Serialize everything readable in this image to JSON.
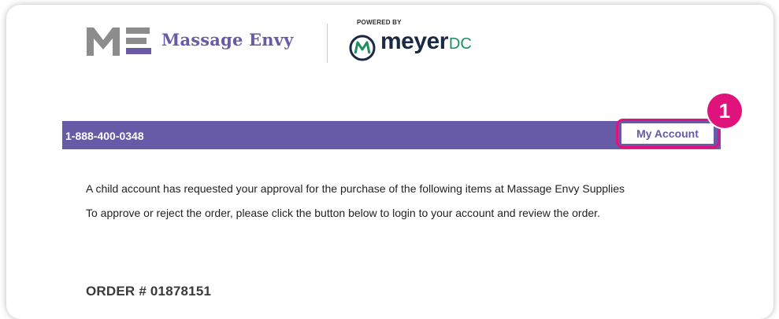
{
  "brand": {
    "mark_icon": "massage-envy-me-mark-icon",
    "name": "Massage Envy",
    "powered_by": "POWERED BY",
    "partner_icon": "meyerdc-m-icon",
    "partner_word": "meyer",
    "partner_suffix": "DC"
  },
  "header_bar": {
    "phone": "1-888-400-0348",
    "account_button": "My Account"
  },
  "annotation": {
    "step_number": "1"
  },
  "body": {
    "paragraph_1": "A child account has requested your approval for the purchase of the following items at Massage Envy Supplies",
    "paragraph_2": "To approve or reject the order, please click the button below to login to your account and review the order.",
    "order_label": "ORDER # 01878151"
  },
  "colors": {
    "brand_purple": "#675aa6",
    "highlight_pink": "#e0137d",
    "meyer_navy": "#1a2a44",
    "meyer_green": "#1e8f5e"
  }
}
